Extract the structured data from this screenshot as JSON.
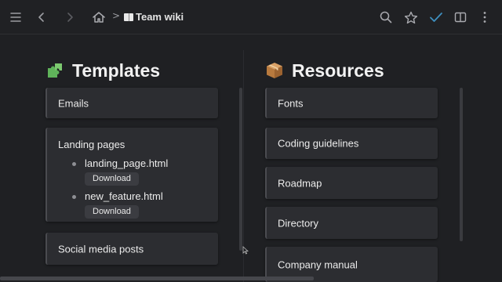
{
  "toolbar": {
    "menu_icon": "hamburger-icon",
    "back_icon": "chevron-left-icon",
    "forward_icon": "chevron-right-icon",
    "home_icon": "home-icon",
    "breadcrumb_separator": ">",
    "page_icon": "book-icon",
    "page_title": "Team wiki",
    "search_icon": "search-icon",
    "favorite_icon": "star-icon",
    "check_icon": "check-icon",
    "layout_icon": "split-view-icon",
    "more_icon": "kebab-menu-icon"
  },
  "colors": {
    "background": "#1f2023",
    "card": "#2c2d31",
    "check_accent": "#3e8fbf"
  },
  "templates": {
    "emoji": "puzzle-piece",
    "title": "Templates",
    "items": [
      {
        "label": "Emails"
      },
      {
        "label": "Landing pages",
        "files": [
          {
            "name": "landing_page.html",
            "action": "Download"
          },
          {
            "name": "new_feature.html",
            "action": "Download"
          }
        ]
      },
      {
        "label": "Social media posts"
      }
    ]
  },
  "resources": {
    "emoji": "package-box",
    "title": "Resources",
    "items": [
      {
        "label": "Fonts"
      },
      {
        "label": "Coding guidelines"
      },
      {
        "label": "Roadmap"
      },
      {
        "label": "Directory"
      },
      {
        "label": "Company manual"
      }
    ]
  }
}
